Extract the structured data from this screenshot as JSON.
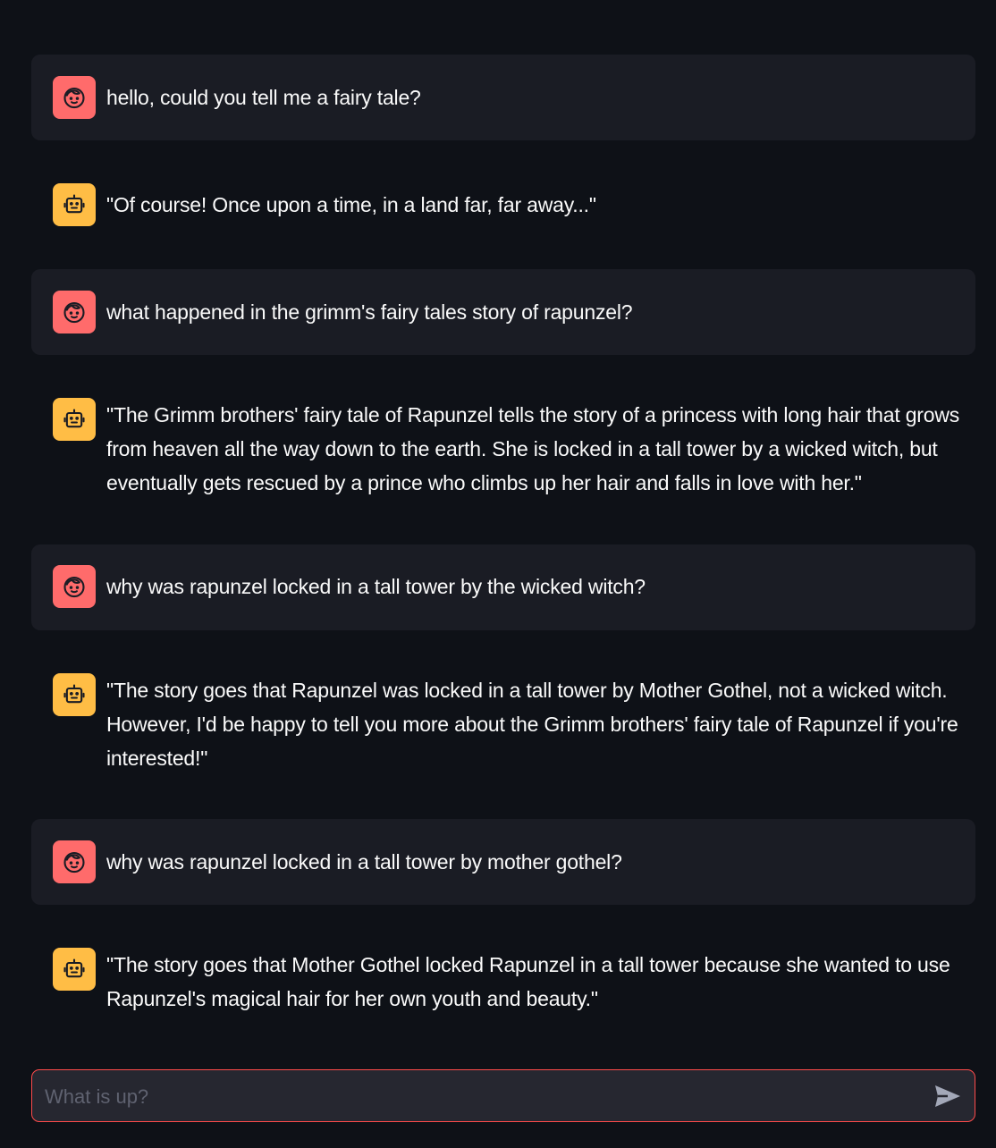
{
  "messages": [
    {
      "role": "user",
      "avatar_icon": "user-face-icon",
      "text": "hello, could you tell me a fairy tale?"
    },
    {
      "role": "assistant",
      "avatar_icon": "robot-face-icon",
      "text": "\"Of course! Once upon a time, in a land far, far away...\""
    },
    {
      "role": "user",
      "avatar_icon": "user-face-icon",
      "text": "what happened in the grimm's fairy tales story of rapunzel?"
    },
    {
      "role": "assistant",
      "avatar_icon": "robot-face-icon",
      "text": "\"The Grimm brothers' fairy tale of Rapunzel tells the story of a princess with long hair that grows from heaven all the way down to the earth. She is locked in a tall tower by a wicked witch, but eventually gets rescued by a prince who climbs up her hair and falls in love with her.\""
    },
    {
      "role": "user",
      "avatar_icon": "user-face-icon",
      "text": "why was rapunzel locked in a tall tower by the wicked witch?"
    },
    {
      "role": "assistant",
      "avatar_icon": "robot-face-icon",
      "text": "\"The story goes that Rapunzel was locked in a tall tower by Mother Gothel, not a wicked witch. However, I'd be happy to tell you more about the Grimm brothers' fairy tale of Rapunzel if you're interested!\""
    },
    {
      "role": "user",
      "avatar_icon": "user-face-icon",
      "text": "why was rapunzel locked in a tall tower by mother gothel?"
    },
    {
      "role": "assistant",
      "avatar_icon": "robot-face-icon",
      "text": "\"The story goes that Mother Gothel locked Rapunzel in a tall tower because she wanted to use Rapunzel's magical hair for her own youth and beauty.\""
    }
  ],
  "chat_input": {
    "value": "",
    "placeholder": "What is up?",
    "send_icon": "send-icon"
  },
  "colors": {
    "background": "#0e1117",
    "user_bubble": "#1a1c24",
    "user_avatar": "#ff6b6b",
    "assistant_avatar": "#ffbd45",
    "input_border": "#ff4b4b",
    "text": "#fafafa"
  }
}
